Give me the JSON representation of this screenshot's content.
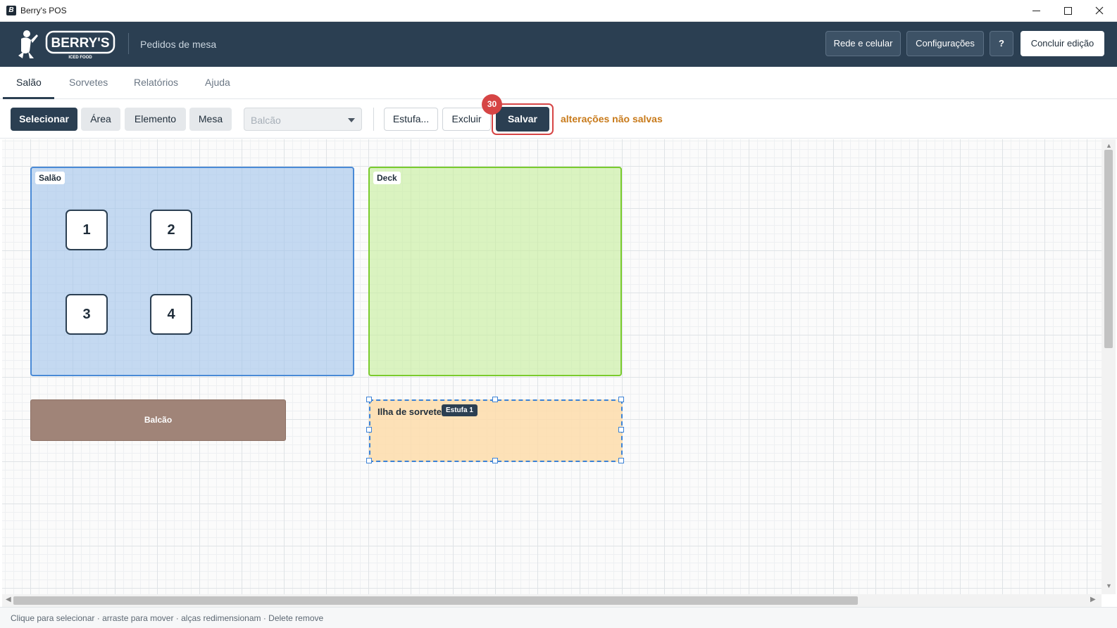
{
  "window": {
    "title": "Berry's POS"
  },
  "header": {
    "logo_text": "BERRY'S",
    "logo_tagline": "ICED FOOD",
    "subtitle": "Pedidos de mesa",
    "buttons": {
      "rede": "Rede e celular",
      "config": "Configurações",
      "help": "?",
      "concluir": "Concluir edição"
    }
  },
  "tabs": [
    {
      "label": "Salão",
      "active": true
    },
    {
      "label": "Sorvetes",
      "active": false
    },
    {
      "label": "Relatórios",
      "active": false
    },
    {
      "label": "Ajuda",
      "active": false
    }
  ],
  "toolbar": {
    "tools": [
      "Selecionar",
      "Área",
      "Elemento",
      "Mesa"
    ],
    "active_tool": "Selecionar",
    "select_value": "Balcão",
    "estufa": "Estufa...",
    "excluir": "Excluir",
    "salvar": "Salvar",
    "badge": "30",
    "unsaved": "alterações não salvas"
  },
  "canvas": {
    "areas": {
      "salao": {
        "label": "Salão",
        "color": "#4a8ad6"
      },
      "deck": {
        "label": "Deck",
        "color": "#7acb2d"
      }
    },
    "mesas": [
      "1",
      "2",
      "3",
      "4"
    ],
    "balcao": {
      "label": "Balcão",
      "color": "#a08478"
    },
    "ilha": {
      "label": "Ilha de sorvete",
      "tag": "Estufa 1",
      "selected": true
    }
  },
  "statusbar": {
    "hint": "Clique para selecionar · arraste para mover · alças redimensionam · Delete remove"
  },
  "colors": {
    "primary": "#2b3f52",
    "alert": "#d64545",
    "warning_text": "#c87a1a"
  }
}
